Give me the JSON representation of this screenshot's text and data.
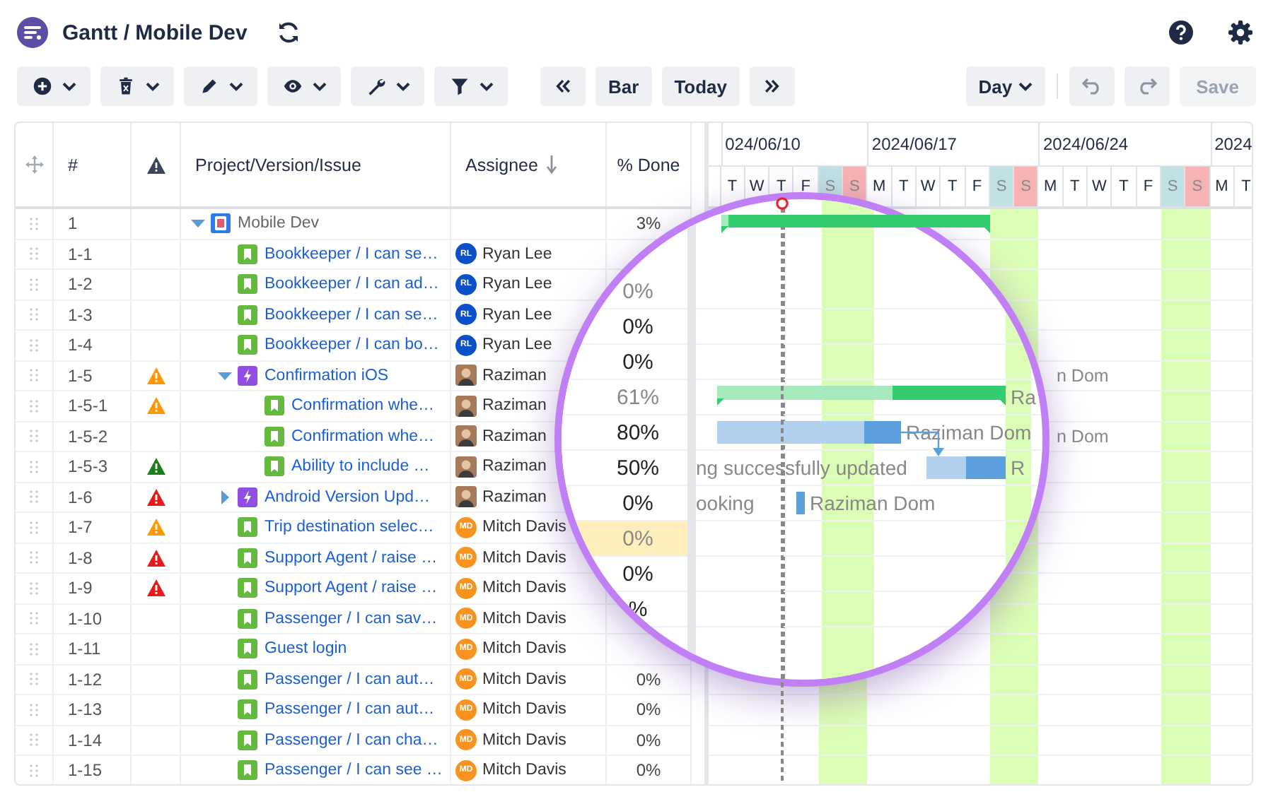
{
  "app": {
    "title": "Gantt / Mobile Dev"
  },
  "toolbar": {
    "nav": [
      {
        "kind": "prev"
      },
      {
        "kind": "text",
        "label": "Bar"
      },
      {
        "kind": "text",
        "label": "Today"
      },
      {
        "kind": "next"
      }
    ],
    "scale": {
      "label": "Day"
    },
    "save": {
      "label": "Save",
      "disabled": true
    }
  },
  "table": {
    "columns": [
      {
        "kind": "drag"
      },
      {
        "kind": "text",
        "label": "#",
        "sorted": false
      },
      {
        "kind": "alert"
      },
      {
        "kind": "text",
        "label": "Project/Version/Issue",
        "sorted": false
      },
      {
        "kind": "text",
        "label": "Assignee",
        "sorted": true
      },
      {
        "kind": "text",
        "label": "% Done",
        "sorted": false
      }
    ],
    "rows": [
      {
        "id": "1",
        "kind": "project",
        "title": "Mobile Dev",
        "expanded": true,
        "done": "3%",
        "bar": {
          "kind": "summary",
          "level": 0.03
        },
        "children": [
          {
            "id": "1-1",
            "kind": "story",
            "title": "Bookkeeper / I can se…",
            "assignee": {
              "name": "Ryan Lee",
              "kind": "initials",
              "initials": "RL",
              "color": "#0b4fc9"
            }
          },
          {
            "id": "1-2",
            "kind": "story",
            "title": "Bookkeeper / I can ad…",
            "assignee": {
              "name": "Ryan Lee",
              "kind": "initials",
              "initials": "RL",
              "color": "#0b4fc9"
            }
          },
          {
            "id": "1-3",
            "kind": "story",
            "title": "Bookkeeper / I can se…",
            "assignee": {
              "name": "Ryan Lee",
              "kind": "initials",
              "initials": "RL",
              "color": "#0b4fc9"
            }
          },
          {
            "id": "1-4",
            "kind": "story",
            "title": "Bookkeeper / I can bo…",
            "assignee": {
              "name": "Ryan Lee",
              "kind": "initials",
              "initials": "RL",
              "color": "#0b4fc9"
            }
          },
          {
            "id": "1-5",
            "kind": "epic",
            "title": "Confirmation iOS",
            "alert": {
              "color": "#ff9800"
            },
            "expanded": true,
            "assignee": {
              "name": "Raziman",
              "kind": "photo"
            },
            "gantt_label": "n Dom",
            "children": [
              {
                "id": "1-5-1",
                "kind": "story",
                "title": "Confirmation whe…",
                "alert": {
                  "color": "#ff9800"
                },
                "assignee": {
                  "name": "Raziman",
                  "kind": "photo"
                }
              },
              {
                "id": "1-5-2",
                "kind": "story",
                "title": "Confirmation whe…",
                "assignee": {
                  "name": "Raziman",
                  "kind": "photo"
                },
                "gantt_label": "n Dom"
              },
              {
                "id": "1-5-3",
                "kind": "story",
                "title": "Ability to include …",
                "alert": {
                  "color": "#1a7f1a"
                },
                "assignee": {
                  "name": "Raziman",
                  "kind": "photo"
                }
              }
            ]
          },
          {
            "id": "1-6",
            "kind": "epic",
            "title": "Android Version Upd…",
            "alert": {
              "color": "#e61c1c"
            },
            "expanded": false,
            "assignee": {
              "name": "Raziman",
              "kind": "photo"
            }
          },
          {
            "id": "1-7",
            "kind": "story",
            "title": "Trip destination selec…",
            "alert": {
              "color": "#ff9800"
            },
            "assignee": {
              "name": "Mitch Davis",
              "kind": "initials",
              "initials": "MD",
              "color": "#f7931e"
            }
          },
          {
            "id": "1-8",
            "kind": "story",
            "title": "Support Agent / raise …",
            "alert": {
              "color": "#e61c1c"
            },
            "assignee": {
              "name": "Mitch Davis",
              "kind": "initials",
              "initials": "MD",
              "color": "#f7931e"
            }
          },
          {
            "id": "1-9",
            "kind": "story",
            "title": "Support Agent / raise …",
            "alert": {
              "color": "#e61c1c"
            },
            "assignee": {
              "name": "Mitch Davis",
              "kind": "initials",
              "initials": "MD",
              "color": "#f7931e"
            }
          },
          {
            "id": "1-10",
            "kind": "story",
            "title": "Passenger / I can sav…",
            "assignee": {
              "name": "Mitch Davis",
              "kind": "initials",
              "initials": "MD",
              "color": "#f7931e"
            }
          },
          {
            "id": "1-11",
            "kind": "story",
            "title": "Guest login",
            "assignee": {
              "name": "Mitch Davis",
              "kind": "initials",
              "initials": "MD",
              "color": "#f7931e"
            }
          },
          {
            "id": "1-12",
            "kind": "story",
            "title": "Passenger / I can aut…",
            "done": "0%",
            "assignee": {
              "name": "Mitch Davis",
              "kind": "initials",
              "initials": "MD",
              "color": "#f7931e"
            }
          },
          {
            "id": "1-13",
            "kind": "story",
            "title": "Passenger / I can aut…",
            "done": "0%",
            "assignee": {
              "name": "Mitch Davis",
              "kind": "initials",
              "initials": "MD",
              "color": "#f7931e"
            }
          },
          {
            "id": "1-14",
            "kind": "story",
            "title": "Passenger / I can cha…",
            "done": "0%",
            "assignee": {
              "name": "Mitch Davis",
              "kind": "initials",
              "initials": "MD",
              "color": "#f7931e"
            }
          },
          {
            "id": "1-15",
            "kind": "story",
            "title": "Passenger / I can see …",
            "done": "0%",
            "assignee": {
              "name": "Mitch Davis",
              "kind": "initials",
              "initials": "MD",
              "color": "#f7931e"
            }
          }
        ]
      }
    ]
  },
  "gantt": {
    "weeks": [
      {
        "label": "024/06/10",
        "days": [
          {
            "letter": "T",
            "kind": "weekday",
            "today": false
          },
          {
            "letter": "W",
            "kind": "weekday",
            "today": false
          },
          {
            "letter": "T",
            "kind": "weekday",
            "today": true
          },
          {
            "letter": "F",
            "kind": "weekday",
            "today": false
          },
          {
            "letter": "S",
            "kind": "saturday",
            "today": false
          },
          {
            "letter": "S",
            "kind": "sunday",
            "today": false
          }
        ]
      },
      {
        "label": "2024/06/17",
        "days": [
          {
            "letter": "M",
            "kind": "weekday",
            "today": false
          },
          {
            "letter": "T",
            "kind": "weekday",
            "today": false
          },
          {
            "letter": "W",
            "kind": "weekday",
            "today": false
          },
          {
            "letter": "T",
            "kind": "weekday",
            "today": false
          },
          {
            "letter": "F",
            "kind": "weekday",
            "today": false
          },
          {
            "letter": "S",
            "kind": "saturday",
            "today": false
          },
          {
            "letter": "S",
            "kind": "sunday",
            "today": false
          }
        ]
      },
      {
        "label": "2024/06/24",
        "days": [
          {
            "letter": "M",
            "kind": "weekday",
            "today": false
          },
          {
            "letter": "T",
            "kind": "weekday",
            "today": false
          },
          {
            "letter": "W",
            "kind": "weekday",
            "today": false
          },
          {
            "letter": "T",
            "kind": "weekday",
            "today": false
          },
          {
            "letter": "F",
            "kind": "weekday",
            "today": false
          },
          {
            "letter": "S",
            "kind": "saturday",
            "today": false
          },
          {
            "letter": "S",
            "kind": "sunday",
            "today": false
          }
        ]
      },
      {
        "label": "2024",
        "days": [
          {
            "letter": "M",
            "kind": "weekday",
            "today": false
          },
          {
            "letter": "T",
            "kind": "weekday",
            "today": false
          }
        ]
      }
    ]
  },
  "magnifier": {
    "rows": [
      {
        "done": "0%",
        "muted": true,
        "selected": false
      },
      {
        "done": "0%",
        "muted": false,
        "selected": false
      },
      {
        "done": "0%",
        "muted": false,
        "selected": false
      },
      {
        "done": "61%",
        "muted": true,
        "selected": false,
        "bar": {
          "kind": "summary",
          "level": 0.61
        },
        "label_after": "Ra"
      },
      {
        "done": "80%",
        "muted": false,
        "selected": false,
        "bar": {
          "kind": "task",
          "level": 0.8
        },
        "label_after": "Raziman Dom",
        "link_to_next": true
      },
      {
        "done": "50%",
        "muted": false,
        "selected": false,
        "label_before": "ng successfully updated",
        "bar": {
          "kind": "task",
          "level": 0.5
        },
        "label_after": "R"
      },
      {
        "done": "0%",
        "muted": false,
        "selected": false,
        "label_before": "ooking",
        "bar": {
          "kind": "collapsed"
        },
        "label_after": "Raziman Dom"
      },
      {
        "done": "0%",
        "muted": true,
        "selected": true
      },
      {
        "done": "0%",
        "muted": false,
        "selected": false
      },
      {
        "done": "%",
        "muted": false,
        "selected": false
      }
    ]
  }
}
